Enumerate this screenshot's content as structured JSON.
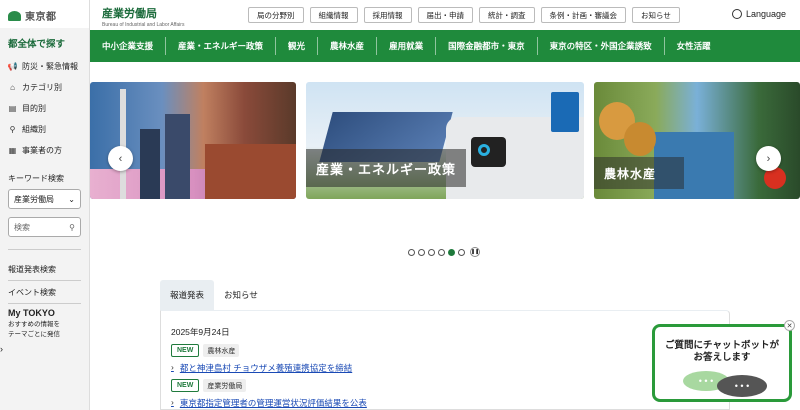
{
  "sidebar": {
    "logo_text": "東京都",
    "section_title": "都全体で探す",
    "items": [
      {
        "label": "防災・緊急情報",
        "icon": "megaphone-icon"
      },
      {
        "label": "カテゴリ別",
        "icon": "tag-icon"
      },
      {
        "label": "目的別",
        "icon": "document-icon"
      },
      {
        "label": "組織別",
        "icon": "org-chart-icon"
      },
      {
        "label": "事業者の方",
        "icon": "building-icon"
      }
    ],
    "keyword_label": "キーワード検索",
    "select_value": "産業労働局",
    "search_placeholder": "検索",
    "links": [
      "報道発表検索",
      "イベント検索"
    ],
    "mytokyo_title": "My TOKYO",
    "mytokyo_desc_1": "おすすめの情報を",
    "mytokyo_desc_2": "テーマごとに発信"
  },
  "header": {
    "bureau_ja": "産業労働局",
    "bureau_en": "Bureau of Industrial and Labor Affairs",
    "top_links": [
      "局の分野別",
      "組織情報",
      "採用情報",
      "届出・申請",
      "統計・調査",
      "条例・計画・審議会",
      "お知らせ"
    ],
    "language": "Language"
  },
  "nav": [
    "中小企業支援",
    "産業・エネルギー政策",
    "観光",
    "農林水産",
    "雇用就業",
    "国際金融都市・東京",
    "東京の特区・外国企業誘致",
    "女性活躍"
  ],
  "carousel": {
    "slide2_caption": "産業・エネルギー政策",
    "slide3_caption": "農林水産",
    "total_dots": 6,
    "active_dot": 5
  },
  "news": {
    "tabs": [
      "報道発表",
      "お知らせ"
    ],
    "date": "2025年9月24日",
    "items": [
      {
        "badge": "NEW",
        "category": "農林水産",
        "title": "都と神津島村 チョウザメ養殖連携協定を締結"
      },
      {
        "badge": "NEW",
        "category": "産業労働局",
        "title": "東京都指定管理者の管理運営状況評価結果を公表"
      }
    ]
  },
  "chatbot": {
    "line1": "ご質問にチャットボットが",
    "line2": "お答えします"
  },
  "colors": {
    "brand_green": "#1f8a3c",
    "link_blue": "#1a4ab5"
  }
}
